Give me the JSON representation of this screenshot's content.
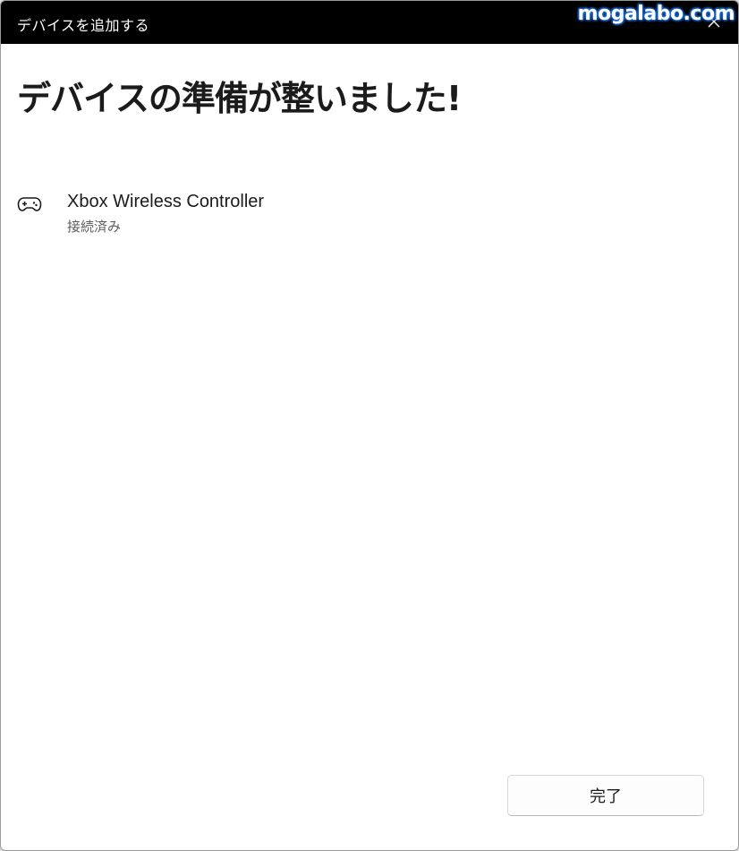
{
  "window": {
    "title": "デバイスを追加する",
    "close_icon": "close-icon"
  },
  "watermark": "mogalabo.com",
  "main": {
    "heading": "デバイスの準備が整いました!",
    "device": {
      "icon": "gamepad-icon",
      "name": "Xbox Wireless Controller",
      "status": "接続済み"
    }
  },
  "footer": {
    "done_label": "完了"
  },
  "colors": {
    "titlebar_bg": "#000000",
    "window_bg": "#ffffff",
    "heading_text": "#1b1b1b",
    "secondary_text": "#5d5d5d",
    "watermark_glow": "#1e6fd9"
  }
}
